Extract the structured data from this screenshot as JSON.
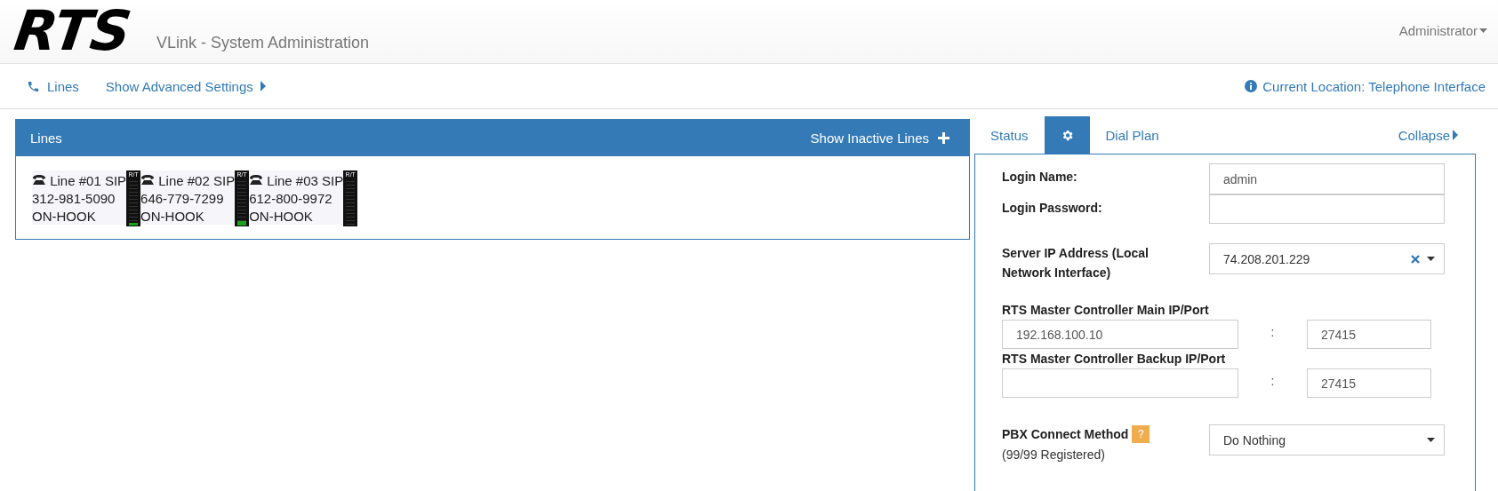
{
  "header": {
    "logo": "RTS",
    "title": "VLink - System Administration",
    "user_menu": "Administrator"
  },
  "nav": {
    "links": [
      {
        "label": "Lines",
        "kind": "phone"
      },
      {
        "label": "Show Advanced Settings",
        "kind": "arrow"
      }
    ],
    "location": "Current Location: Telephone Interface"
  },
  "lines_panel": {
    "title": "Lines",
    "action": "Show Inactive Lines",
    "lines": [
      {
        "name": "Line #01 SIP",
        "number": "312-981-5090",
        "status": "ON-HOOK",
        "meter_label": "R/T",
        "level": 0.05
      },
      {
        "name": "Line #02 SIP",
        "number": "646-779-7299",
        "status": "ON-HOOK",
        "meter_label": "R/T",
        "level": 0.1
      },
      {
        "name": "Line #03 SIP",
        "number": "612-800-9972",
        "status": "ON-HOOK",
        "meter_label": "R/T"
      }
    ]
  },
  "settings_panel": {
    "tabs": [
      {
        "label": "Status",
        "kind": "text",
        "selected": false
      },
      {
        "kind": "gear",
        "selected": true
      },
      {
        "label": "Dial Plan",
        "kind": "text",
        "selected": false
      }
    ],
    "collapse": "Collapse",
    "login_name": {
      "label": "Login Name:",
      "value": "admin"
    },
    "login_password": {
      "label": "Login Password:"
    },
    "server_ip": {
      "label": "Server IP Address (Local Network Interface)",
      "value": "74.208.201.229"
    },
    "main_controller": {
      "label": "RTS Master Controller Main IP/Port",
      "ip": "192.168.100.10",
      "separator": ":",
      "port": "27415"
    },
    "backup_controller": {
      "label": "RTS Master Controller Backup IP/Port",
      "separator": ":",
      "port": "27415"
    },
    "pbx": {
      "label": "PBX Connect Method",
      "help": "?",
      "registered": "(99/99 Registered)",
      "value": "Do Nothing"
    }
  }
}
